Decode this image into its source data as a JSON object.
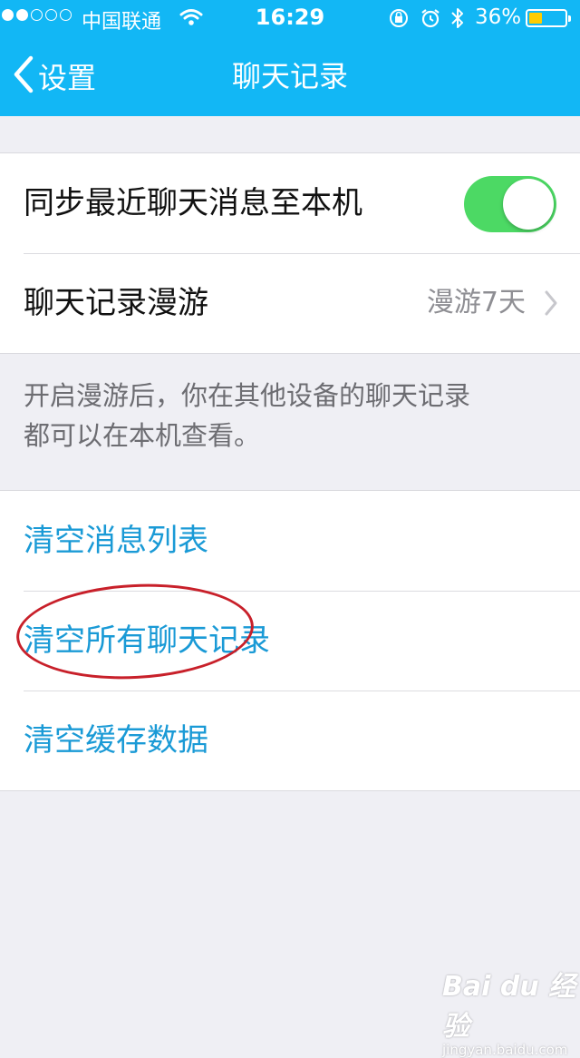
{
  "status_bar": {
    "carrier": "中国联通",
    "time": "16:29",
    "battery_percent": "36%",
    "battery_level": 0.36,
    "signal_bars": 5,
    "signal_filled": 2
  },
  "nav": {
    "back_label": "设置",
    "title": "聊天记录"
  },
  "settings": {
    "sync_label": "同步最近聊天消息至本机",
    "sync_enabled": true,
    "roaming_label": "聊天记录漫游",
    "roaming_value": "漫游7天"
  },
  "footnote": {
    "line1": "开启漫游后，你在其他设备的聊天记录",
    "line2": "都可以在本机查看。"
  },
  "actions": {
    "clear_list": "清空消息列表",
    "clear_all_history": "清空所有聊天记录",
    "clear_cache": "清空缓存数据"
  },
  "watermark": {
    "logo": "Bai du 经验",
    "url": "jingyan.baidu.com"
  },
  "colors": {
    "nav_blue": "#12b7f5",
    "link_blue": "#1a9ad6",
    "toggle_green": "#4cd964",
    "annotation_red": "#c8202a"
  }
}
